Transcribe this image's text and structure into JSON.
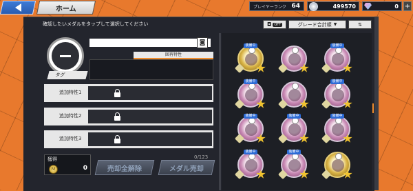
{
  "header": {
    "home_label": "ホーム",
    "player_rank_label": "プレイヤーランク",
    "player_rank_value": "64",
    "coins_value": "499570",
    "gems_value": "0",
    "plus_label": "+"
  },
  "toolbar": {
    "instruction": "確認したいメダルをタップして選択してください",
    "filter_label": "OFF",
    "sort_label": "グレード合計順",
    "sort_arrow": "▼",
    "order_label": "⇅"
  },
  "detail": {
    "unique_trait_label": "固有特性",
    "tag_label": "タグ",
    "extra_traits": [
      {
        "label": "追加特性1"
      },
      {
        "label": "追加特性2"
      },
      {
        "label": "追加特性3"
      }
    ]
  },
  "footer": {
    "fund_label": "獲得",
    "fund_value": "0",
    "unlock_all_label": "売却全解除",
    "sell_label": "メダル売却",
    "count_label": "0/123"
  },
  "medals": [
    {
      "status": "装備中",
      "color": "gold"
    },
    {
      "status": "",
      "color": "pink"
    },
    {
      "status": "装備中",
      "color": "pink"
    },
    {
      "status": "装備中",
      "color": "pink"
    },
    {
      "status": "",
      "color": "pink"
    },
    {
      "status": "装備中",
      "color": "pink"
    },
    {
      "status": "装備中",
      "color": "pink"
    },
    {
      "status": "装備中",
      "color": "pink"
    },
    {
      "status": "装備中",
      "color": "pink"
    },
    {
      "status": "装備中",
      "color": "pink"
    },
    {
      "status": "装備中",
      "color": "pink"
    },
    {
      "status": "",
      "color": "gold"
    }
  ]
}
